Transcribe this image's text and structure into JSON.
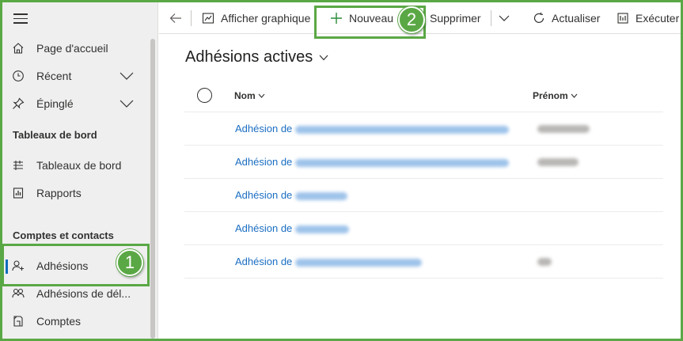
{
  "sidebar": {
    "items": [
      {
        "label": "Page d'accueil",
        "icon": "home-icon"
      },
      {
        "label": "Récent",
        "icon": "clock-icon"
      },
      {
        "label": "Épinglé",
        "icon": "pin-icon"
      }
    ],
    "section_dashboards": "Tableaux de bord",
    "dashboards_items": [
      {
        "label": "Tableaux de bord",
        "icon": "dashboard-icon"
      },
      {
        "label": "Rapports",
        "icon": "report-icon"
      }
    ],
    "section_accounts": "Comptes et contacts",
    "accounts_items": [
      {
        "label": "Adhésions",
        "icon": "person-add-icon",
        "active": true
      },
      {
        "label": "Adhésions de dél...",
        "icon": "people-icon"
      },
      {
        "label": "Comptes",
        "icon": "accounts-icon"
      }
    ]
  },
  "toolbar": {
    "back_icon": "arrow-left-icon",
    "show_chart": "Afficher graphique",
    "new": "Nouveau",
    "delete": "Supprimer",
    "refresh": "Actualiser",
    "run": "Exécuter"
  },
  "view": {
    "title": "Adhésions actives",
    "columns": {
      "name": "Nom",
      "first_name": "Prénom"
    },
    "rows": [
      {
        "name_prefix": "Adhésion de"
      },
      {
        "name_prefix": "Adhésion de"
      },
      {
        "name_prefix": "Adhésion de"
      },
      {
        "name_prefix": "Adhésion de"
      },
      {
        "name_prefix": "Adhésion de"
      }
    ]
  },
  "annotations": {
    "step1": "1",
    "step2": "2",
    "highlight_color": "#5aa845"
  },
  "colors": {
    "link": "#1b6ec2",
    "sidebar_bg": "#efefef",
    "active_indicator": "#0f6cbd"
  }
}
